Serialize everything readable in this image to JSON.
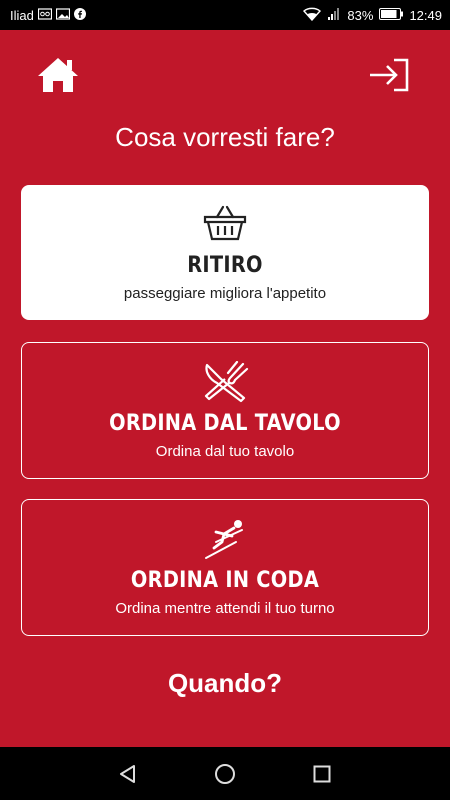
{
  "status": {
    "carrier": "Iliad",
    "battery": "83%",
    "time": "12:49"
  },
  "header": {
    "home_icon": "home-icon",
    "exit_icon": "sign-in-icon",
    "question": "Cosa vorresti fare?"
  },
  "options": [
    {
      "title": "RITIRO",
      "subtitle": "passeggiare migliora l'appetito",
      "icon": "basket-icon"
    },
    {
      "title": "ORDINA DAL TAVOLO",
      "subtitle": "Ordina dal tuo tavolo",
      "icon": "cutlery-icon"
    },
    {
      "title": "ORDINA IN CODA",
      "subtitle": "Ordina mentre attendi il tuo turno",
      "icon": "ski-jump-icon"
    }
  ],
  "when": {
    "label": "Quando?"
  },
  "theme": {
    "background": "#c0172a",
    "card_selected": "#ffffff"
  }
}
